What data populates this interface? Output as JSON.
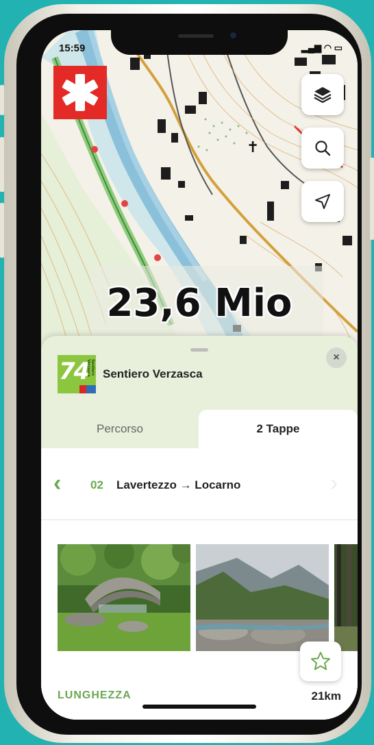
{
  "status_bar": {
    "time": "15:59",
    "indicators": "▂▄▆ ◠ ▭"
  },
  "map": {
    "counter_text": "23,6 Mio",
    "logo_icon": "swiss-cross-asterisk",
    "layers_icon": "layers-icon",
    "search_icon": "search-icon",
    "locate_icon": "navigation-arrow-icon"
  },
  "sheet": {
    "route_number": "74",
    "route_logo_caption": "Sentiero Verzasca",
    "route_name": "Sentiero Verzasca",
    "close_label": "×",
    "tabs": [
      {
        "label": "Percorso",
        "active": false
      },
      {
        "label": "2 Tappe",
        "active": true
      }
    ],
    "stage": {
      "number": "02",
      "name": "Lavertezzo → Locarno"
    },
    "photos": [
      "stone-bridge-photo",
      "river-valley-photo",
      "forest-photo"
    ],
    "length_label": "LUNGHEZZA",
    "length_value": "21km"
  },
  "colors": {
    "accent_green": "#6aa84f",
    "sheet_bg": "#e8f0dc",
    "logo_red": "#e32a26",
    "route_logo_green": "#8cc63f",
    "background_teal": "#22b2b1"
  }
}
